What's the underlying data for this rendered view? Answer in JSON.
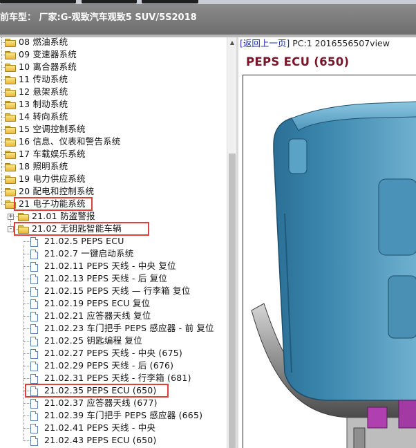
{
  "header": {
    "title": "前车型：  厂家:G-观致汽车观致5 SUV/5S2018"
  },
  "tree": {
    "items": [
      {
        "label": "08 燃油系统"
      },
      {
        "label": "09 变速器系统"
      },
      {
        "label": "10 离合器系统"
      },
      {
        "label": "11 传动系统"
      },
      {
        "label": "12 悬架系统"
      },
      {
        "label": "13 制动系统"
      },
      {
        "label": "14 转向系统"
      },
      {
        "label": "15 空调控制系统"
      },
      {
        "label": "16 信息、仪表和警告系统"
      },
      {
        "label": "17 车载娱乐系统"
      },
      {
        "label": "18 照明系统"
      },
      {
        "label": "19 电力供应系统"
      },
      {
        "label": "20 配电和控制系统"
      },
      {
        "label": "21 电子功能系统"
      },
      {
        "label": "21.01 防盗警报"
      },
      {
        "label": "21.02 无钥匙智能车辆"
      },
      {
        "label": "21.02.5 PEPS ECU"
      },
      {
        "label": "21.02.7 一键启动系统"
      },
      {
        "label": "21.02.11 PEPS 天线 - 中央 复位"
      },
      {
        "label": "21.02.13 PEPS 天线 - 后 复位"
      },
      {
        "label": "21.02.15 PEPS 天线 — 行李箱 复位"
      },
      {
        "label": "21.02.19 PEPS ECU 复位"
      },
      {
        "label": "21.02.21 应答器天线 复位"
      },
      {
        "label": "21.02.23 车门把手 PEPS 感应器 - 前 复位"
      },
      {
        "label": "21.02.25 钥匙编程 复位"
      },
      {
        "label": "21.02.27 PEPS 天线 - 中央 (675)"
      },
      {
        "label": "21.02.29 PEPS 天线 - 后 (676)"
      },
      {
        "label": "21.02.31 PEPS 天线 - 行李箱 (681)"
      },
      {
        "label": "21.02.35 PEPS ECU (650)"
      },
      {
        "label": "21.02.37 应答器天线 (677)"
      },
      {
        "label": "21.02.39 车门把手 PEPS 感应器 (665)"
      },
      {
        "label": "21.02.41 PEPS 天线 - 中央"
      },
      {
        "label": "21.02.43 PEPS ECU (650)"
      }
    ]
  },
  "content": {
    "back_link": "[返回上一页]",
    "page_info": " PC:1 2016556507view",
    "title": "PEPS ECU (650)"
  },
  "colors": {
    "title": "#7a1428",
    "link": "#1a2fa8",
    "highlight": "#e0403a",
    "header_bg": "#7c7c7c"
  }
}
